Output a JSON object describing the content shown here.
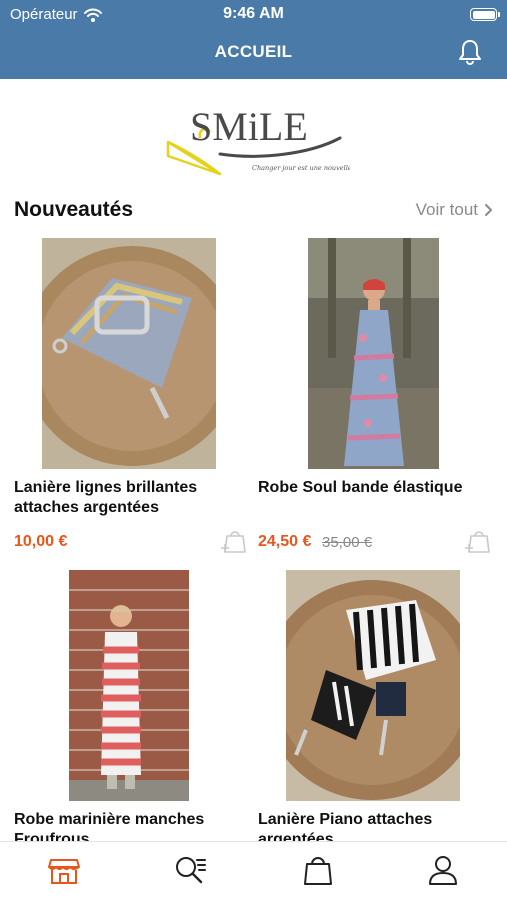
{
  "status_bar": {
    "carrier": "Opérateur",
    "time": "9:46 AM"
  },
  "header": {
    "title": "ACCUEIL"
  },
  "logo": {
    "brand": "SMiLE",
    "tagline": "Changer jour est une nouvelle vie ."
  },
  "section": {
    "title": "Nouveautés",
    "see_all": "Voir tout"
  },
  "products": [
    {
      "name": "Lanière lignes brillantes attaches argentées",
      "price": "10,00 €",
      "old_price": ""
    },
    {
      "name": "Robe Soul bande élastique",
      "price": "24,50 €",
      "old_price": "35,00 €"
    },
    {
      "name": "Robe marinière manches Froufrous",
      "price": "",
      "old_price": ""
    },
    {
      "name": "Lanière Piano attaches argentées",
      "price": "",
      "old_price": ""
    }
  ],
  "tabbar": {
    "items": [
      "shop-icon",
      "search-list-icon",
      "bag-icon",
      "user-icon"
    ]
  },
  "colors": {
    "header": "#4a7aa8",
    "accent": "#e8561c",
    "muted": "#8a8a8a"
  }
}
